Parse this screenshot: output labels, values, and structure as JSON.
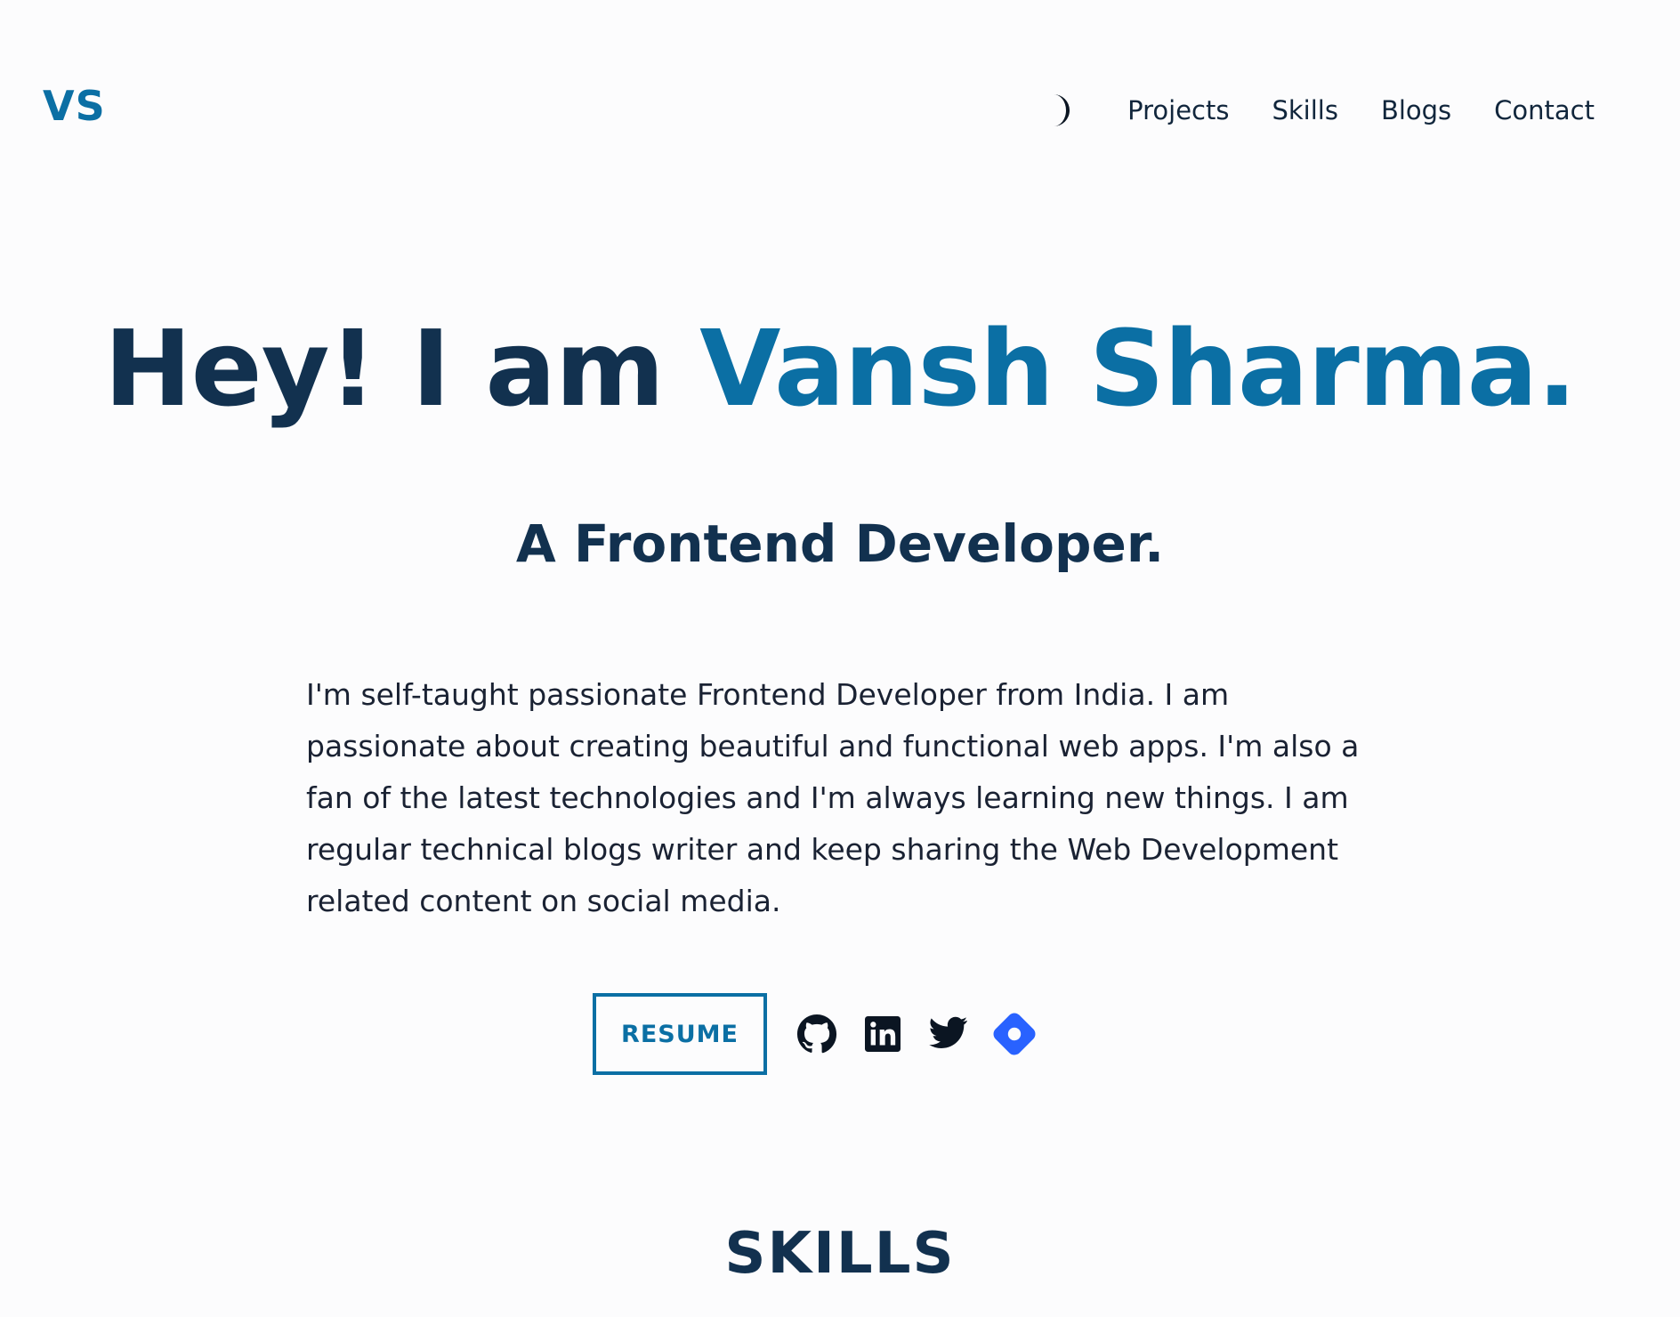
{
  "header": {
    "logo": "VS",
    "theme_toggle_icon": "moon-icon",
    "nav": [
      {
        "label": "Projects"
      },
      {
        "label": "Skills"
      },
      {
        "label": "Blogs"
      },
      {
        "label": "Contact"
      }
    ]
  },
  "hero": {
    "greeting": "Hey! I am ",
    "name": "Vansh Sharma.",
    "subtitle": "A Frontend Developer.",
    "bio": "I'm self-taught passionate Frontend Developer from India. I am passionate about creating beautiful and functional web apps. I'm also a fan of the latest technologies and I'm always learning new things. I am regular technical blogs writer and keep sharing the Web Development related content on social media.",
    "resume_label": "RESUME",
    "social_icons": [
      "github-icon",
      "linkedin-icon",
      "twitter-icon",
      "hashnode-icon"
    ]
  },
  "sections": {
    "skills_heading": "SKILLS"
  },
  "colors": {
    "accent": "#0b6fa4",
    "heading": "#12314f",
    "background": "#fcfcfd",
    "hashnode": "#2962ff"
  }
}
